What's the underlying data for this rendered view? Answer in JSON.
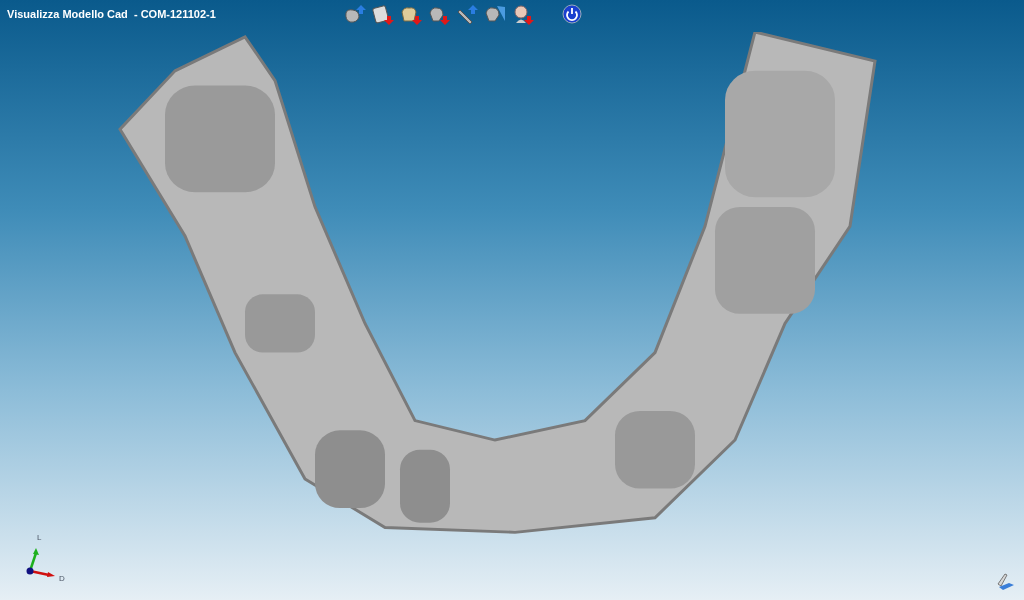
{
  "window": {
    "title": "Visualizza Modello Cad  - COM-121102-1"
  },
  "toolbar": [
    {
      "kind": "model-up"
    },
    {
      "kind": "scan-down"
    },
    {
      "kind": "crown-down"
    },
    {
      "kind": "tooth-down"
    },
    {
      "kind": "bar-up"
    },
    {
      "kind": "cut"
    },
    {
      "kind": "head-down"
    }
  ],
  "axes": {
    "vertical_label": "L",
    "horizontal_label": "D"
  }
}
